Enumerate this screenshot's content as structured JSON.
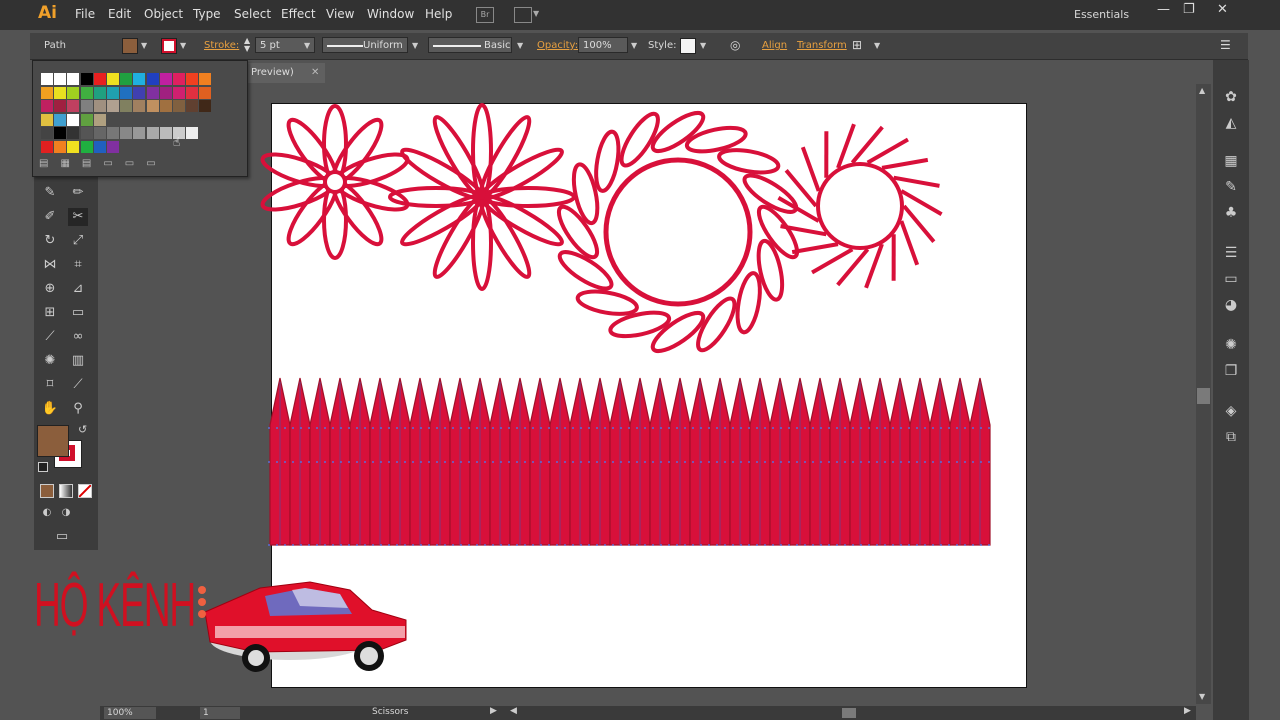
{
  "app": {
    "logo": "Ai"
  },
  "menu": [
    "File",
    "Edit",
    "Object",
    "Type",
    "Select",
    "Effect",
    "View",
    "Window",
    "Help"
  ],
  "workspace": {
    "label": "Essentials"
  },
  "bridge_label": "Br",
  "control": {
    "selection_type": "Path",
    "stroke_label": "Stroke:",
    "stroke_weight": "5 pt",
    "profile": "Uniform",
    "brush": "Basic",
    "opacity_label": "Opacity:",
    "opacity_value": "100%",
    "style_label": "Style:",
    "align_label": "Align",
    "transform_label": "Transform"
  },
  "document_tab": {
    "title": "Preview)"
  },
  "status": {
    "zoom": "100%",
    "page": "1",
    "tool": "Scissors"
  },
  "watermark": {
    "text": "HỘ KÊNH"
  },
  "colors": {
    "fill": "#8b5e3c",
    "stroke": "#d0102c",
    "art": "#d8103a",
    "guide": "#5a6cd8"
  }
}
